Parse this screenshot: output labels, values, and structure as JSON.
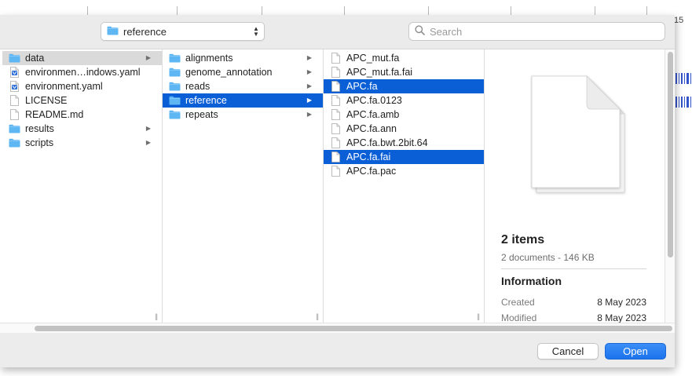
{
  "background": {
    "ruler_number": "15"
  },
  "toolbar": {
    "location": "reference",
    "search_placeholder": "Search"
  },
  "columns": [
    {
      "items": [
        {
          "label": "data",
          "icon": "folder-icon",
          "has_children": true,
          "state": "selected-inactive"
        },
        {
          "label": "environmen…indows.yaml",
          "icon": "yaml-file-icon",
          "has_children": false,
          "state": ""
        },
        {
          "label": "environment.yaml",
          "icon": "yaml-file-icon",
          "has_children": false,
          "state": ""
        },
        {
          "label": "LICENSE",
          "icon": "document-icon",
          "has_children": false,
          "state": ""
        },
        {
          "label": "README.md",
          "icon": "document-icon",
          "has_children": false,
          "state": ""
        },
        {
          "label": "results",
          "icon": "folder-icon",
          "has_children": true,
          "state": ""
        },
        {
          "label": "scripts",
          "icon": "folder-icon",
          "has_children": true,
          "state": ""
        }
      ]
    },
    {
      "items": [
        {
          "label": "alignments",
          "icon": "folder-icon",
          "has_children": true,
          "state": ""
        },
        {
          "label": "genome_annotation",
          "icon": "folder-icon",
          "has_children": true,
          "state": ""
        },
        {
          "label": "reads",
          "icon": "folder-icon",
          "has_children": true,
          "state": ""
        },
        {
          "label": "reference",
          "icon": "folder-icon",
          "has_children": true,
          "state": "selected"
        },
        {
          "label": "repeats",
          "icon": "folder-icon",
          "has_children": true,
          "state": ""
        }
      ]
    },
    {
      "items": [
        {
          "label": "APC_mut.fa",
          "icon": "document-icon",
          "has_children": false,
          "state": ""
        },
        {
          "label": "APC_mut.fa.fai",
          "icon": "document-icon",
          "has_children": false,
          "state": ""
        },
        {
          "label": "APC.fa",
          "icon": "document-icon",
          "has_children": false,
          "state": "selected"
        },
        {
          "label": "APC.fa.0123",
          "icon": "document-icon",
          "has_children": false,
          "state": ""
        },
        {
          "label": "APC.fa.amb",
          "icon": "document-icon",
          "has_children": false,
          "state": ""
        },
        {
          "label": "APC.fa.ann",
          "icon": "document-icon",
          "has_children": false,
          "state": ""
        },
        {
          "label": "APC.fa.bwt.2bit.64",
          "icon": "document-icon",
          "has_children": false,
          "state": ""
        },
        {
          "label": "APC.fa.fai",
          "icon": "document-icon",
          "has_children": false,
          "state": "selected"
        },
        {
          "label": "APC.fa.pac",
          "icon": "document-icon",
          "has_children": false,
          "state": ""
        }
      ]
    }
  ],
  "preview": {
    "count": "2 items",
    "subtitle": "2 documents - 146 KB",
    "info_heading": "Information",
    "meta": [
      {
        "key": "Created",
        "value": "8 May 2023"
      },
      {
        "key": "Modified",
        "value": "8 May 2023"
      }
    ]
  },
  "footer": {
    "cancel_label": "Cancel",
    "open_label": "Open"
  },
  "colors": {
    "selection_blue": "#0a5fd6",
    "folder_blue": "#5eb6f3",
    "open_button": "#1b73ec"
  }
}
